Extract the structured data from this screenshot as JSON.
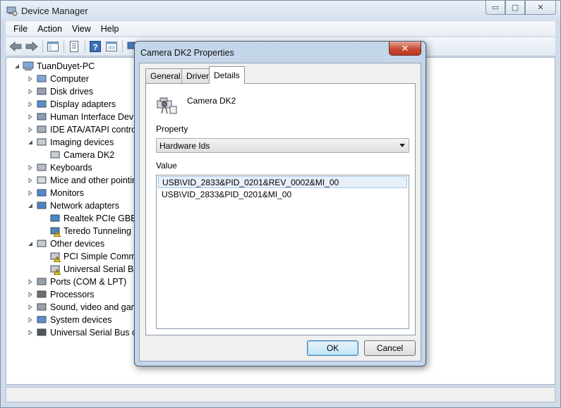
{
  "window": {
    "title": "Device Manager",
    "minimize": "▭",
    "restore": "▢",
    "close": "✕"
  },
  "menu": [
    "File",
    "Action",
    "View",
    "Help"
  ],
  "toolbar": {
    "icons": [
      "back-arrow-icon",
      "forward-arrow-icon",
      "show-hide-tree-icon",
      "properties-icon",
      "help-icon",
      "view-icon",
      "scan-hardware-icon"
    ]
  },
  "tree": {
    "root": "TuanDuyet-PC",
    "items": [
      {
        "label": "Computer",
        "icon": "computer-icon",
        "level": 1,
        "state": "collapsed"
      },
      {
        "label": "Disk drives",
        "icon": "disk-drive-icon",
        "level": 1,
        "state": "collapsed"
      },
      {
        "label": "Display adapters",
        "icon": "display-adapter-icon",
        "level": 1,
        "state": "collapsed"
      },
      {
        "label": "Human Interface Devic",
        "icon": "hid-icon",
        "level": 1,
        "state": "collapsed"
      },
      {
        "label": "IDE ATA/ATAPI contro",
        "icon": "ide-icon",
        "level": 1,
        "state": "collapsed"
      },
      {
        "label": "Imaging devices",
        "icon": "camera-icon",
        "level": 1,
        "state": "expanded"
      },
      {
        "label": "Camera DK2",
        "icon": "camera-icon",
        "level": 2,
        "state": "leaf"
      },
      {
        "label": "Keyboards",
        "icon": "keyboard-icon",
        "level": 1,
        "state": "collapsed"
      },
      {
        "label": "Mice and other pointin",
        "icon": "mouse-icon",
        "level": 1,
        "state": "collapsed"
      },
      {
        "label": "Monitors",
        "icon": "monitor-icon",
        "level": 1,
        "state": "collapsed"
      },
      {
        "label": "Network adapters",
        "icon": "network-icon",
        "level": 1,
        "state": "expanded"
      },
      {
        "label": "Realtek PCIe GBE F",
        "icon": "network-icon",
        "level": 2,
        "state": "leaf"
      },
      {
        "label": "Teredo Tunneling I",
        "icon": "network-warning-icon",
        "level": 2,
        "state": "leaf"
      },
      {
        "label": "Other devices",
        "icon": "unknown-device-icon",
        "level": 1,
        "state": "expanded"
      },
      {
        "label": "PCI Simple Comm",
        "icon": "warning-device-icon",
        "level": 2,
        "state": "leaf"
      },
      {
        "label": "Universal Serial Bus",
        "icon": "warning-device-icon",
        "level": 2,
        "state": "leaf"
      },
      {
        "label": "Ports (COM & LPT)",
        "icon": "port-icon",
        "level": 1,
        "state": "collapsed"
      },
      {
        "label": "Processors",
        "icon": "processor-icon",
        "level": 1,
        "state": "collapsed"
      },
      {
        "label": "Sound, video and gam",
        "icon": "sound-icon",
        "level": 1,
        "state": "collapsed"
      },
      {
        "label": "System devices",
        "icon": "system-icon",
        "level": 1,
        "state": "collapsed"
      },
      {
        "label": "Universal Serial Bus co",
        "icon": "usb-icon",
        "level": 1,
        "state": "collapsed"
      }
    ]
  },
  "dialog": {
    "title": "Camera DK2 Properties",
    "close": "✕",
    "tabs": [
      "General",
      "Driver",
      "Details"
    ],
    "active_tab": "Details",
    "device_name": "Camera DK2",
    "property_label": "Property",
    "property_value": "Hardware Ids",
    "value_label": "Value",
    "values": [
      "USB\\VID_2833&PID_0201&REV_0002&MI_00",
      "USB\\VID_2833&PID_0201&MI_00"
    ],
    "selected_value_index": 0,
    "ok_label": "OK",
    "cancel_label": "Cancel"
  },
  "colors": {
    "chrome": "#cfdbe9",
    "selection": "#e7f0fa",
    "close_button": "#c74a34"
  }
}
